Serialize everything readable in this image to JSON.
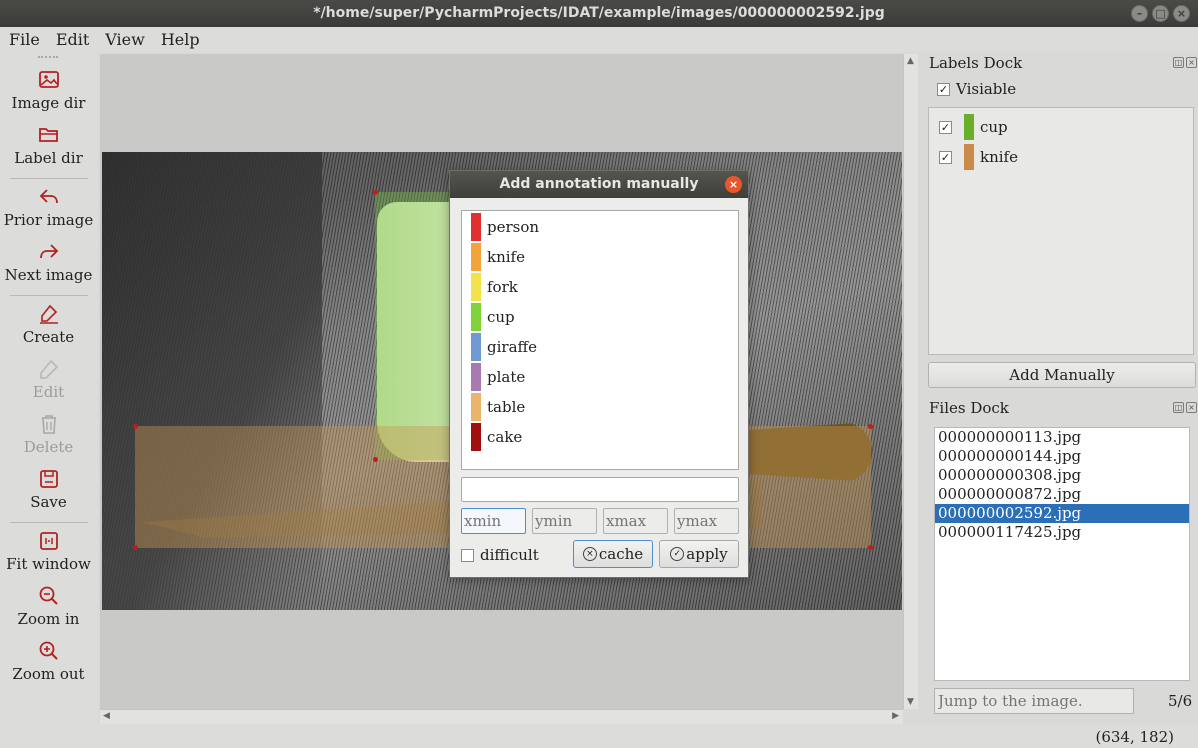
{
  "window": {
    "title": "*/home/super/PycharmProjects/IDAT/example/images/000000002592.jpg"
  },
  "menu": [
    "File",
    "Edit",
    "View",
    "Help"
  ],
  "toolbar": {
    "image_dir": "Image dir",
    "label_dir": "Label dir",
    "prior_image": "Prior image",
    "next_image": "Next image",
    "create": "Create",
    "edit": "Edit",
    "delete": "Delete",
    "save": "Save",
    "fit_window": "Fit window",
    "zoom_in": "Zoom in",
    "zoom_out": "Zoom out"
  },
  "labels_dock": {
    "title": "Labels Dock",
    "visible_label": "Visiable",
    "items": [
      {
        "name": "cup",
        "color": "#6aae2a"
      },
      {
        "name": "knife",
        "color": "#c98a4a"
      }
    ],
    "add_manually": "Add Manually"
  },
  "files_dock": {
    "title": "Files Dock",
    "files": [
      "000000000113.jpg",
      "000000000144.jpg",
      "000000000308.jpg",
      "000000000872.jpg",
      "000000002592.jpg",
      "000000117425.jpg"
    ],
    "selected_index": 4,
    "jump_placeholder": "Jump to the image.",
    "page": "5/6"
  },
  "status": {
    "coords": "(634, 182)"
  },
  "dialog": {
    "title": "Add annotation manually",
    "classes": [
      {
        "name": "person",
        "color": "#e03131"
      },
      {
        "name": "knife",
        "color": "#f2a33a"
      },
      {
        "name": "fork",
        "color": "#f4e24a"
      },
      {
        "name": "cup",
        "color": "#7fd23a"
      },
      {
        "name": "giraffe",
        "color": "#6f9ad2"
      },
      {
        "name": "plate",
        "color": "#a87bb0"
      },
      {
        "name": "table",
        "color": "#eab56a"
      },
      {
        "name": "cake",
        "color": "#a01010"
      }
    ],
    "xmin_placeholder": "xmin",
    "ymin_placeholder": "ymin",
    "xmax_placeholder": "xmax",
    "ymax_placeholder": "ymax",
    "difficult_label": "difficult",
    "cache_label": "cache",
    "apply_label": "apply"
  }
}
